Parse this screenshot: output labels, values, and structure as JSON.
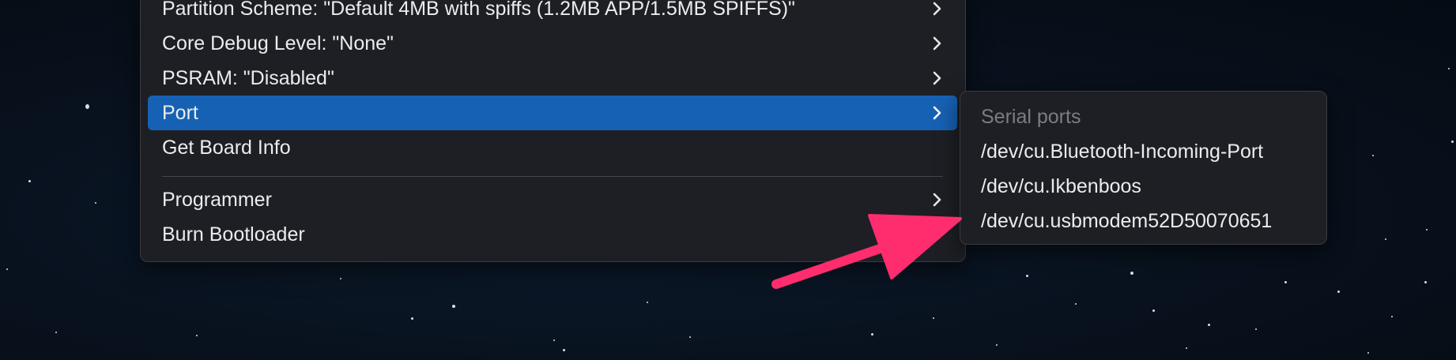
{
  "menu": {
    "items": [
      {
        "label": "Partition Scheme: \"Default 4MB with spiffs (1.2MB APP/1.5MB SPIFFS)\"",
        "has_submenu": true
      },
      {
        "label": "Core Debug Level: \"None\"",
        "has_submenu": true
      },
      {
        "label": "PSRAM: \"Disabled\"",
        "has_submenu": true
      },
      {
        "label": "Port",
        "has_submenu": true,
        "active": true
      },
      {
        "label": "Get Board Info",
        "has_submenu": false
      },
      {
        "label": "Programmer",
        "has_submenu": true
      },
      {
        "label": "Burn Bootloader",
        "has_submenu": false
      }
    ]
  },
  "port_submenu": {
    "header": "Serial ports",
    "ports": [
      "/dev/cu.Bluetooth-Incoming-Port",
      "/dev/cu.Ikbenboos",
      "/dev/cu.usbmodem52D50070651"
    ]
  },
  "colors": {
    "highlight": "#1761b4",
    "menu_background": "#1e1f24",
    "annotation_arrow": "#ff2d6e"
  },
  "icons": {
    "submenu_indicator": "chevron-right-icon"
  }
}
